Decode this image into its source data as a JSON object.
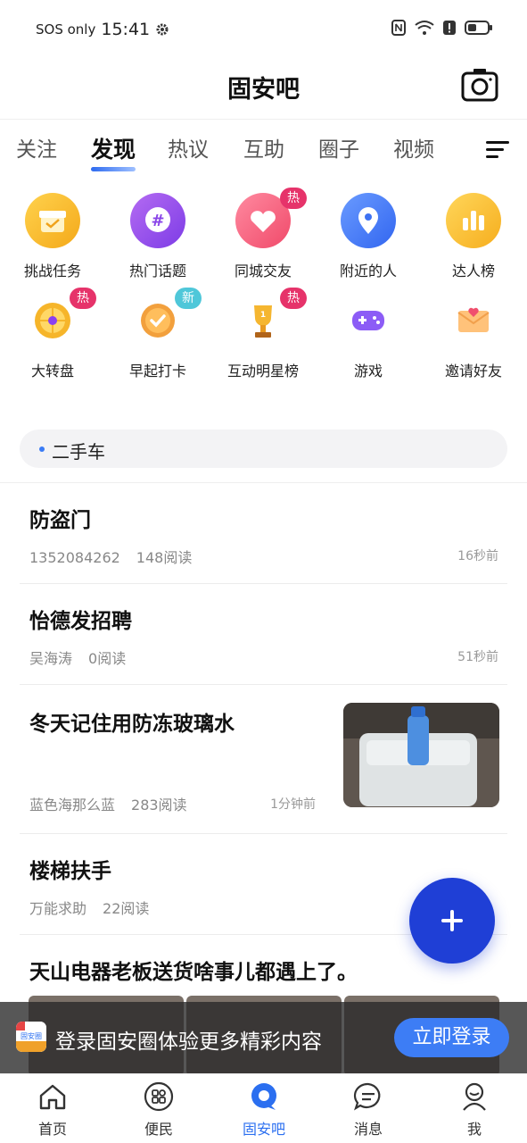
{
  "status": {
    "carrier": "SOS only",
    "time": "15:41"
  },
  "header": {
    "title": "固安吧"
  },
  "tabs": [
    {
      "label": "关注",
      "active": false
    },
    {
      "label": "发现",
      "active": true
    },
    {
      "label": "热议",
      "active": false
    },
    {
      "label": "互助",
      "active": false
    },
    {
      "label": "圈子",
      "active": false
    },
    {
      "label": "视频",
      "active": false
    }
  ],
  "grid": [
    {
      "label": "挑战任务",
      "icon": "gift-box-icon",
      "badge": ""
    },
    {
      "label": "热门话题",
      "icon": "hashtag-icon",
      "badge": ""
    },
    {
      "label": "同城交友",
      "icon": "hearts-icon",
      "badge": "热"
    },
    {
      "label": "附近的人",
      "icon": "location-pin-icon",
      "badge": ""
    },
    {
      "label": "达人榜",
      "icon": "bar-chart-icon",
      "badge": ""
    },
    {
      "label": "大转盘",
      "icon": "wheel-icon",
      "badge": "热"
    },
    {
      "label": "早起打卡",
      "icon": "checkmark-circle-icon",
      "badge": "新"
    },
    {
      "label": "互动明星榜",
      "icon": "trophy-icon",
      "badge": "热"
    },
    {
      "label": "游戏",
      "icon": "gamepad-icon",
      "badge": ""
    },
    {
      "label": "邀请好友",
      "icon": "envelope-heart-icon",
      "badge": ""
    }
  ],
  "category": {
    "label": "二手车"
  },
  "posts": [
    {
      "title": "防盗门",
      "author": "1352084262",
      "reads": "148阅读",
      "time": "16秒前",
      "has_image": false
    },
    {
      "title": "怡德发招聘",
      "author": "吴海涛",
      "reads": "0阅读",
      "time": "51秒前",
      "has_image": false
    },
    {
      "title": "冬天记住用防冻玻璃水",
      "author": "蓝色海那么蓝",
      "reads": "283阅读",
      "time": "1分钟前",
      "has_image": true
    },
    {
      "title": "楼梯扶手",
      "author": "万能求助",
      "reads": "22阅读",
      "time": "",
      "has_image": false
    },
    {
      "title": "天山电器老板送货啥事儿都遇上了。",
      "author": "",
      "reads": "",
      "time": "",
      "has_image": true
    }
  ],
  "banner": {
    "message": "登录固安圈体验更多精彩内容",
    "button": "立即登录",
    "logo_text": "固安圈"
  },
  "bottom_nav": [
    {
      "label": "首页",
      "icon": "home-icon",
      "active": false
    },
    {
      "label": "便民",
      "icon": "grid-services-icon",
      "active": false
    },
    {
      "label": "固安吧",
      "icon": "chat-bubble-icon",
      "active": true
    },
    {
      "label": "消息",
      "icon": "message-icon",
      "active": false
    },
    {
      "label": "我",
      "icon": "profile-icon",
      "active": false
    }
  ],
  "colors": {
    "accent": "#2b6ff0",
    "fab": "#1f3fd6",
    "hot_badge": "#e6336a",
    "new_badge": "#4fc7d9"
  }
}
